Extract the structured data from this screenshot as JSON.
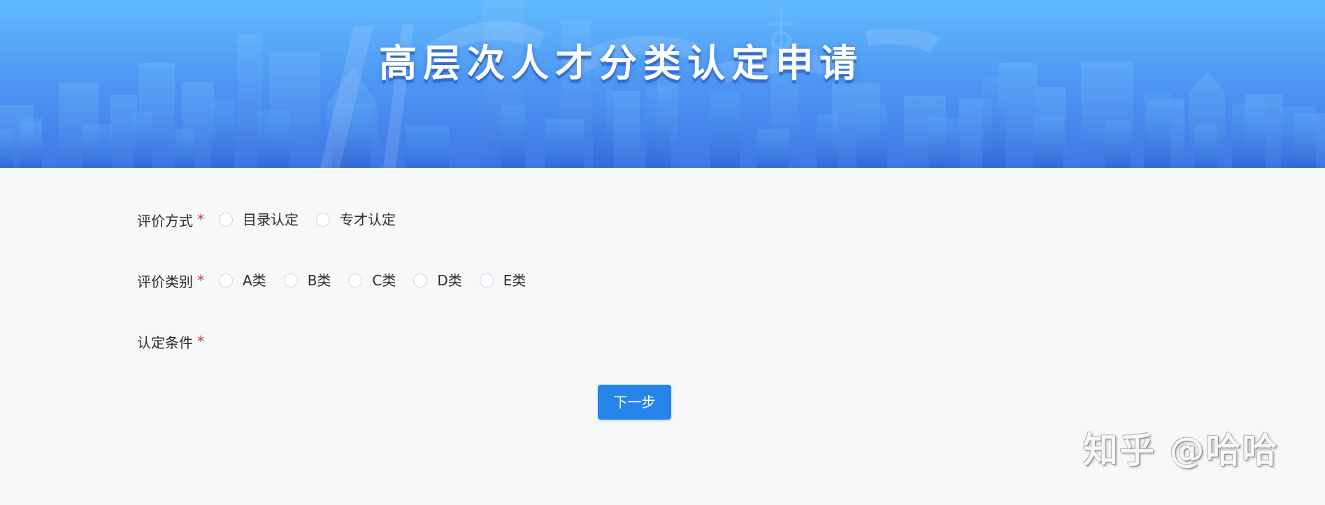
{
  "banner": {
    "title": "高层次人才分类认定申请",
    "background_colors": [
      "#62bafc",
      "#4e97f5",
      "#3f77e5"
    ]
  },
  "form": {
    "required_marker": "*",
    "evaluation_method": {
      "label": "评价方式",
      "options": [
        "目录认定",
        "专才认定"
      ]
    },
    "evaluation_category": {
      "label": "评价类别",
      "options": [
        "A类",
        "B类",
        "C类",
        "D类",
        "E类"
      ]
    },
    "conditions": {
      "label": "认定条件"
    },
    "next_button": "下一步"
  },
  "watermark": "知乎 @哈哈",
  "colors": {
    "page_background": "#f7f8fa",
    "primary_button": "#2585e8",
    "required_mark": "#d93838"
  }
}
